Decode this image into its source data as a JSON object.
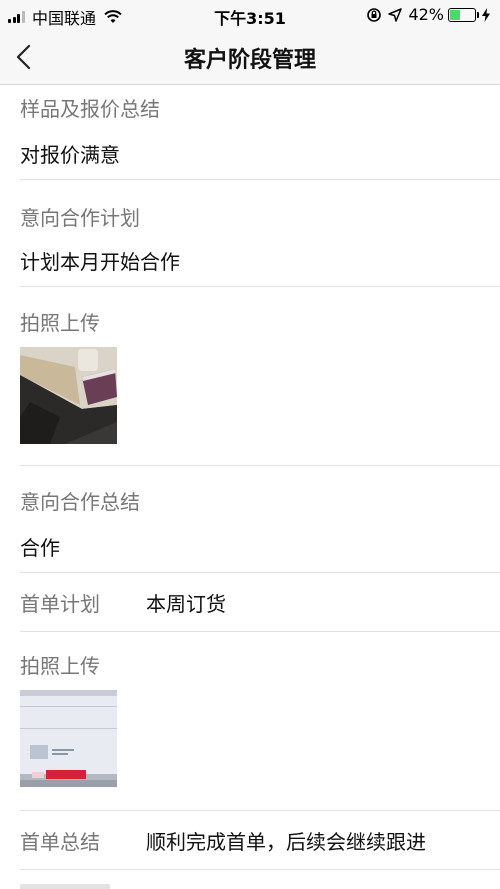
{
  "status_bar": {
    "carrier": "中国联通",
    "time": "下午3:51",
    "battery_percent": "42%",
    "battery_level": 0.42
  },
  "nav": {
    "title": "客户阶段管理"
  },
  "sections": {
    "sample_quote_summary": {
      "label": "样品及报价总结",
      "value": "对报价满意"
    },
    "intent_plan": {
      "label": "意向合作计划",
      "value": "计划本月开始合作"
    },
    "photo_upload_1": {
      "label": "拍照上传"
    },
    "intent_summary": {
      "label": "意向合作总结",
      "value": "合作"
    },
    "first_order_plan": {
      "label": "首单计划",
      "value": "本周订货"
    },
    "photo_upload_2": {
      "label": "拍照上传"
    },
    "first_order_summary": {
      "label": "首单总结",
      "value": "顺利完成首单，后续会继续跟进"
    }
  },
  "icons": {
    "back": "chevron-left-icon",
    "wifi": "wifi-icon",
    "orientation_lock": "orientation-lock-icon",
    "location": "location-arrow-icon",
    "charging": "charging-bolt-icon"
  },
  "colors": {
    "label": "#777777",
    "value": "#111111",
    "divider": "#e2e2e2",
    "battery": "#4cd964"
  }
}
